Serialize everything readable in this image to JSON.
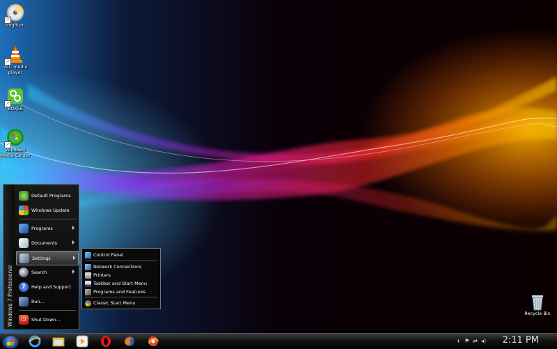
{
  "desktop": {
    "icons": [
      {
        "label": "ImgBurn",
        "icon": "imgburn-disc-icon"
      },
      {
        "label": "VLC media player",
        "icon": "vlc-cone-icon"
      },
      {
        "label": "BOXEE",
        "icon": "boxee-icon"
      },
      {
        "label": "Windows Media Center",
        "icon": "windows-media-center-icon"
      }
    ],
    "recycle_bin": "Recycle Bin"
  },
  "start_menu": {
    "sidebar_text": "Windows 7 Professional",
    "items": [
      {
        "label": "Default Programs",
        "icon": "default-programs-icon",
        "submenu": false
      },
      {
        "label": "Windows Update",
        "icon": "windows-update-icon",
        "submenu": false
      },
      {
        "label": "Programs",
        "icon": "programs-icon",
        "submenu": true
      },
      {
        "label": "Documents",
        "icon": "documents-icon",
        "submenu": true
      },
      {
        "label": "Settings",
        "icon": "settings-icon",
        "submenu": true,
        "highlighted": true
      },
      {
        "label": "Search",
        "icon": "search-icon",
        "submenu": true
      },
      {
        "label": "Help and Support",
        "icon": "help-icon",
        "submenu": false
      },
      {
        "label": "Run...",
        "icon": "run-icon",
        "submenu": false
      },
      {
        "label": "Shut Down...",
        "icon": "shutdown-icon",
        "submenu": false
      }
    ]
  },
  "settings_submenu": {
    "items": [
      {
        "label": "Control Panel",
        "icon": "control-panel-icon"
      },
      {
        "label": "Network Connections",
        "icon": "network-icon"
      },
      {
        "label": "Printers",
        "icon": "printer-icon"
      },
      {
        "label": "Taskbar and Start Menu",
        "icon": "taskbar-icon"
      },
      {
        "label": "Programs and Features",
        "icon": "programs-features-icon"
      },
      {
        "label": "Classic Start Menu",
        "icon": "classic-start-icon"
      }
    ]
  },
  "taskbar": {
    "pinned": [
      "internet-explorer-icon",
      "explorer-folder-icon",
      "media-player-icon",
      "opera-icon",
      "firefox-icon",
      "chrome-like-icon"
    ],
    "clock": "2:11 PM",
    "tray_icons": [
      "plus-icon",
      "flag-icon",
      "network-icon",
      "volume-icon"
    ]
  }
}
